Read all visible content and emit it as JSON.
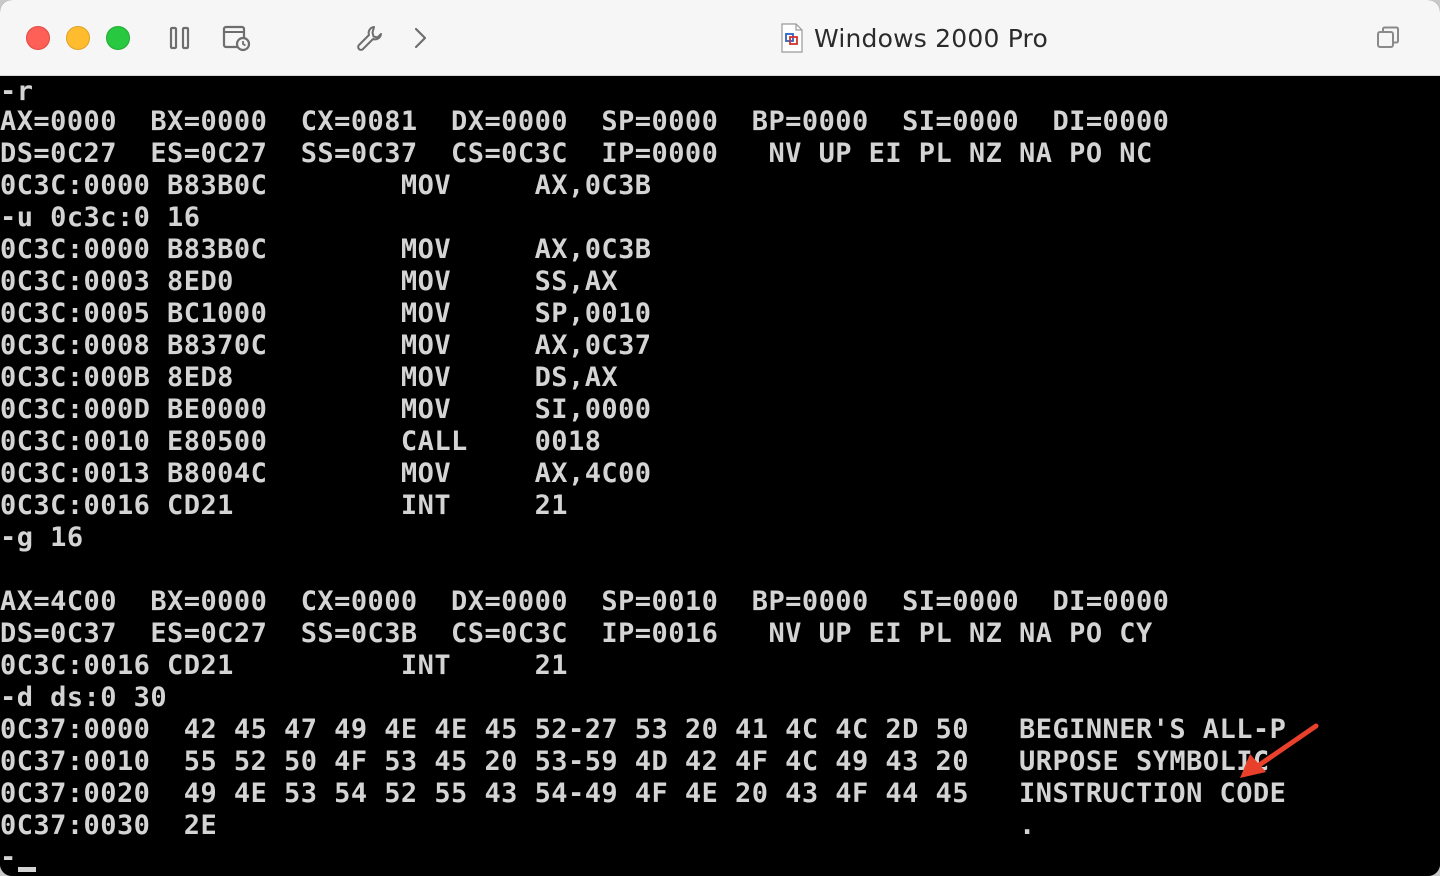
{
  "window": {
    "title": "Windows 2000 Pro"
  },
  "toolbar": {
    "icons": [
      "sidebar-toggle-icon",
      "snapshot-icon",
      "wrench-icon",
      "chevron-right-icon",
      "restore-window-icon"
    ]
  },
  "colors": {
    "terminal_background": "#000000",
    "terminal_text": "#d4d4d4",
    "annotation_arrow": "#e8402a"
  },
  "terminal": {
    "lines": [
      "-r",
      "AX=0000  BX=0000  CX=0081  DX=0000  SP=0000  BP=0000  SI=0000  DI=0000",
      "DS=0C27  ES=0C27  SS=0C37  CS=0C3C  IP=0000   NV UP EI PL NZ NA PO NC",
      "0C3C:0000 B83B0C        MOV     AX,0C3B",
      "-u 0c3c:0 16",
      "0C3C:0000 B83B0C        MOV     AX,0C3B",
      "0C3C:0003 8ED0          MOV     SS,AX",
      "0C3C:0005 BC1000        MOV     SP,0010",
      "0C3C:0008 B8370C        MOV     AX,0C37",
      "0C3C:000B 8ED8          MOV     DS,AX",
      "0C3C:000D BE0000        MOV     SI,0000",
      "0C3C:0010 E80500        CALL    0018",
      "0C3C:0013 B8004C        MOV     AX,4C00",
      "0C3C:0016 CD21          INT     21",
      "-g 16",
      "",
      "AX=4C00  BX=0000  CX=0000  DX=0000  SP=0010  BP=0000  SI=0000  DI=0000",
      "DS=0C37  ES=0C27  SS=0C3B  CS=0C3C  IP=0016   NV UP EI PL NZ NA PO CY",
      "0C3C:0016 CD21          INT     21",
      "-d ds:0 30",
      "0C37:0000  42 45 47 49 4E 4E 45 52-27 53 20 41 4C 4C 2D 50   BEGINNER'S ALL-P",
      "0C37:0010  55 52 50 4F 53 45 20 53-59 4D 42 4F 4C 49 43 20   URPOSE SYMBOLIC",
      "0C37:0020  49 4E 53 54 52 55 43 54-49 4F 4E 20 43 4F 44 45   INSTRUCTION CODE",
      "0C37:0030  2E                                                .",
      "-"
    ]
  }
}
